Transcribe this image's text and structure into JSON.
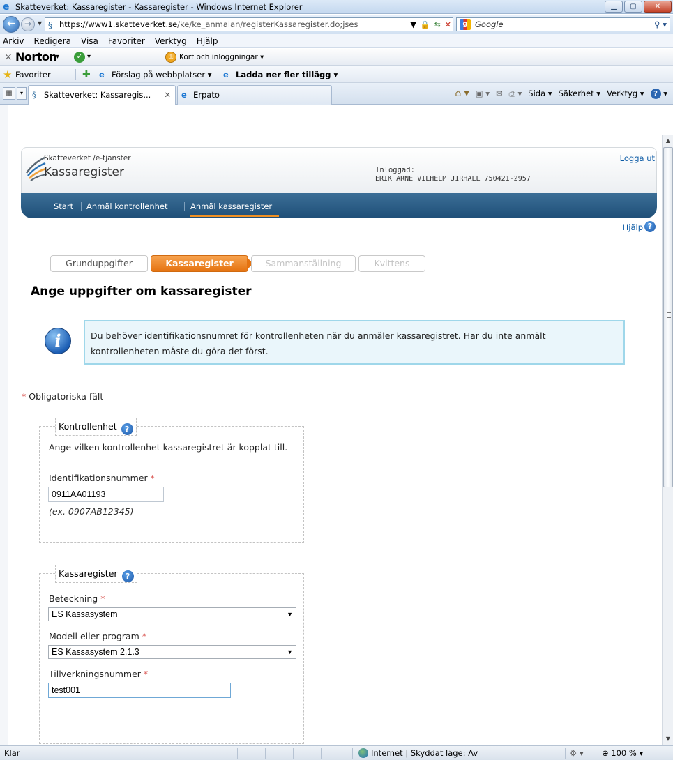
{
  "browser": {
    "window_title": "Skatteverket: Kassaregister - Kassaregister - Windows Internet Explorer",
    "url_host": "https://www1.skatteverket.se",
    "url_path": "/ke/ke_anmalan/registerKassaregister.do;jses",
    "search_placeholder": "Google",
    "menu": [
      "Arkiv",
      "Redigera",
      "Visa",
      "Favoriter",
      "Verktyg",
      "Hjälp"
    ],
    "norton_logo": "Norton",
    "norton_cards": "Kort och inloggningar ▾",
    "favorites_label": "Favoriter",
    "fav_links": [
      "Förslag på webbplatser ▾",
      "Ladda ner fler tillägg ▾"
    ],
    "tabs": [
      {
        "label": "Skatteverket: Kassaregis...",
        "active": true
      },
      {
        "label": "Erpato",
        "active": false
      }
    ],
    "commands": {
      "page": "Sida ▾",
      "security": "Säkerhet ▾",
      "tools": "Verktyg ▾"
    },
    "status_text": "Klar",
    "status_zone": "Internet | Skyddat läge: Av",
    "zoom": "100 %"
  },
  "site": {
    "brand_sub": "Skatteverket /e-tjänster",
    "brand_title": "Kassaregister",
    "logged_label": "Inloggad:",
    "logged_name": "ERIK ARNE VILHELM JIRHALL 750421-2957",
    "logout": "Logga ut",
    "nav": [
      "Start",
      "Anmäl kontrollenhet",
      "Anmäl kassaregister"
    ],
    "help": "Hjälp"
  },
  "steps": [
    "Grunduppgifter",
    "Kassaregister",
    "Sammanställning",
    "Kvittens"
  ],
  "page": {
    "title": "Ange uppgifter om kassaregister",
    "info": "Du behöver identifikationsnumret för kontrollenheten när du anmäler kassaregistret. Har du inte anmält kontrollenheten måste du göra det först.",
    "required_note": "Obligatoriska fält"
  },
  "kontrollenhet": {
    "legend": "Kontrollenhet",
    "description": "Ange vilken kontrollenhet kassaregistret är kopplat till.",
    "id_label": "Identifikationsnummer",
    "id_value": "0911AA01193",
    "id_example": "(ex. 0907AB12345)"
  },
  "kassaregister": {
    "legend": "Kassaregister",
    "beteckning_label": "Beteckning",
    "beteckning_value": "ES Kassasystem",
    "modell_label": "Modell eller program",
    "modell_value": "ES Kassasystem 2.1.3",
    "tillverkning_label": "Tillverkningsnummer",
    "tillverkning_value": "test001"
  },
  "colors": {
    "nav_bg": "#1f4f78",
    "step_active": "#e57311",
    "info_bg": "#eaf6fb",
    "required": "#d9534f",
    "link": "#0b5aa5"
  }
}
